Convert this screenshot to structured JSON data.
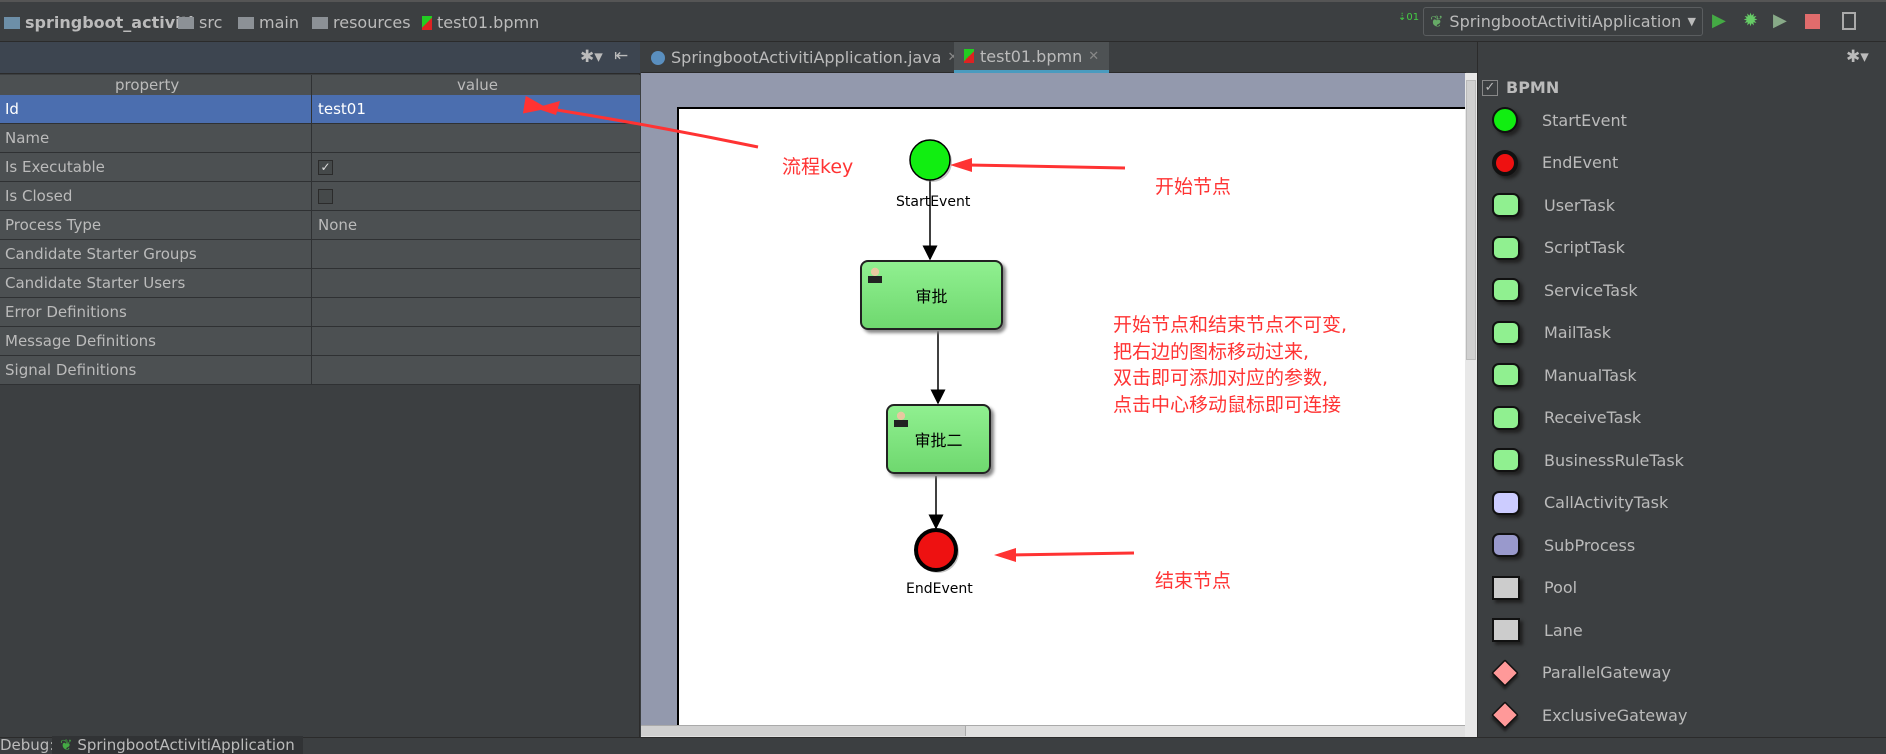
{
  "breadcrumb": [
    "springboot_activiti",
    "src",
    "main",
    "resources",
    "test01.bpmn"
  ],
  "run_config": "SpringbootActivitiApplication",
  "properties": {
    "headers": [
      "property",
      "value"
    ],
    "rows": [
      {
        "property": "Id",
        "value": "test01",
        "selected": true
      },
      {
        "property": "Name",
        "value": ""
      },
      {
        "property": "Is Executable",
        "checkbox": true,
        "checked": true
      },
      {
        "property": "Is Closed",
        "checkbox": true,
        "checked": false
      },
      {
        "property": "Process Type",
        "value": "None"
      },
      {
        "property": "Candidate Starter Groups",
        "value": ""
      },
      {
        "property": "Candidate Starter Users",
        "value": ""
      },
      {
        "property": "Error Definitions",
        "value": ""
      },
      {
        "property": "Message Definitions",
        "value": ""
      },
      {
        "property": "Signal Definitions",
        "value": ""
      }
    ]
  },
  "tabs": [
    {
      "label": "SpringbootActivitiApplication.java",
      "active": false
    },
    {
      "label": "test01.bpmn",
      "active": true
    }
  ],
  "diagram": {
    "start_label": "StartEvent",
    "task1": "审批",
    "task2": "审批二",
    "end_label": "EndEvent"
  },
  "annotations": {
    "key": "流程key",
    "start": "开始节点",
    "end": "结束节点",
    "note": [
      "开始节点和结束节点不可变,",
      "把右边的图标移动过来,",
      "双击即可添加对应的参数,",
      "点击中心移动鼠标即可连接"
    ],
    "color": "#ff3333"
  },
  "palette": {
    "title": "BPMN",
    "items": [
      "StartEvent",
      "EndEvent",
      "UserTask",
      "ScriptTask",
      "ServiceTask",
      "MailTask",
      "ManualTask",
      "ReceiveTask",
      "BusinessRuleTask",
      "CallActivityTask",
      "SubProcess",
      "Pool",
      "Lane",
      "ParallelGateway",
      "ExclusiveGateway"
    ]
  },
  "bottom": {
    "debug": "Debug:",
    "session": "SpringbootActivitiApplication"
  }
}
